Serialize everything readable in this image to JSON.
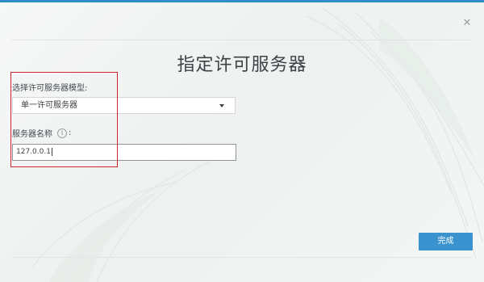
{
  "dialog": {
    "title": "指定许可服务器",
    "close_icon": "close-icon",
    "accent_color": "#2d8fc6"
  },
  "form": {
    "model_label": "选择许可服务器模型:",
    "model_selected": "单一许可服务器",
    "name_label": "服务器名称",
    "name_info_icon": "info-icon",
    "name_label_suffix": ":",
    "name_value": "127.0.0.1"
  },
  "annotation": {
    "highlight_color": "#c9262f"
  },
  "footer": {
    "finish_label": "完成",
    "finish_color": "#3a93cf"
  }
}
